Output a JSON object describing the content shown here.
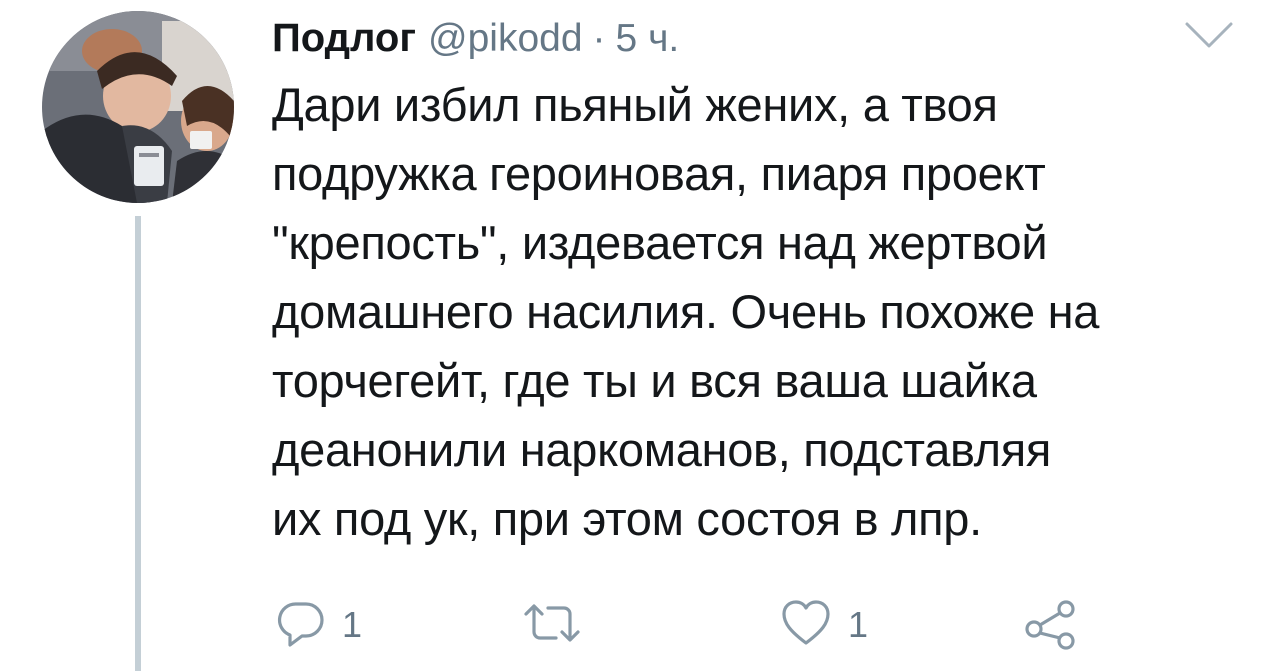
{
  "tweet": {
    "display_name": "Подлог",
    "handle": "@pikodd",
    "separator": "·",
    "time": "5 ч.",
    "text_lines": [
      "Дари избил пьяный жених, а твоя",
      "подружка героиновая, пиаря проект",
      "\"крепость\", издевается над жертвой",
      "домашнего насилия. Очень похоже на",
      "торчегейт, где ты и вся ваша шайка",
      "деанонили наркоманов, подставляя",
      "их под ук, при этом состоя в лпр."
    ],
    "text": "Дари избил пьяный жених, а твоя\nподружка героиновая, пиаря проект\n\"крепость\", издевается над жертвой\nдомашнего насилия. Очень похоже на\nторчегейт, где ты и вся ваша шайка\nдеанонили наркоманов, подставляя\nих под ук, при этом состоя в лпр."
  },
  "actions": {
    "reply_count": "1",
    "retweet_count": "",
    "like_count": "1"
  },
  "icons": {
    "reply": "reply-icon",
    "retweet": "retweet-icon",
    "like": "heart-icon",
    "share": "share-icon",
    "menu": "chevron-down-icon"
  },
  "colors": {
    "text": "#14171a",
    "secondary": "#657786",
    "thread_line": "#c4cfd6",
    "icon": "#8899a6"
  }
}
